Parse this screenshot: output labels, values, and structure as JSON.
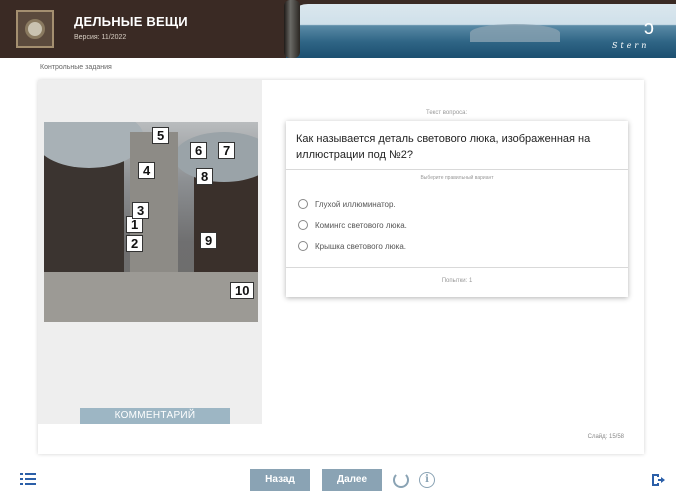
{
  "header": {
    "title": "ДЕЛЬНЫЕ ВЕЩИ",
    "version": "Версия: 11/2022",
    "brand": "Stern"
  },
  "breadcrumb": "Контрольные задания",
  "left_panel": {
    "image_labels": [
      "1",
      "2",
      "3",
      "4",
      "5",
      "6",
      "7",
      "8",
      "9",
      "10"
    ],
    "comment_button": "КОММЕНТАРИЙ"
  },
  "question": {
    "caption": "Текст вопроса:",
    "text": "Как называется деталь светового люка, изображенная на иллюстрации под №2?",
    "hint": "Выберите правильный вариант",
    "options": [
      "Глухой иллюминатор.",
      "Комингс светового люка.",
      "Крышка светового люка."
    ],
    "attempts": "Попытки: 1"
  },
  "slide_counter": "Слайд: 15/58",
  "nav": {
    "back": "Назад",
    "next": "Далее",
    "menu_icon": "list-menu-icon",
    "reload_icon": "reload-icon",
    "info_icon": "info-icon",
    "info_glyph": "i",
    "exit_icon": "exit-icon"
  },
  "colors": {
    "header_bg": "#3a2a24",
    "button_bg": "#8aa3b4",
    "accent_blue": "#2b5fa8"
  }
}
